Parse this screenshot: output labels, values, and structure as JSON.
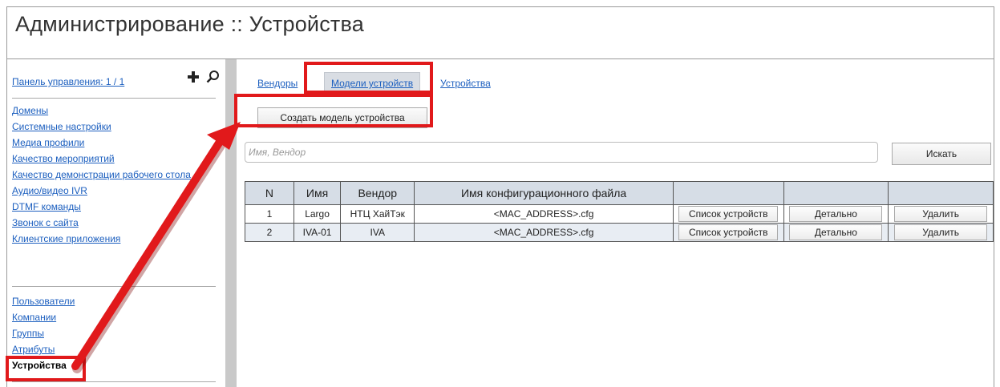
{
  "page_title": "Администрирование :: Устройства",
  "sidebar": {
    "panel_link": "Панель управления: 1 / 1",
    "add_icon": "plus-icon",
    "search_icon": "magnifier-icon",
    "group1": [
      "Домены",
      "Системные настройки",
      "Медиа профили",
      "Качество мероприятий",
      "Качество демонстрации рабочего стола",
      "Аудио/видео IVR",
      "DTMF команды",
      "Звонок с сайта",
      "Клиентские приложения"
    ],
    "group2": [
      "Пользователи",
      "Компании",
      "Группы",
      "Атрибуты",
      "Устройства"
    ],
    "active_item": "Устройства"
  },
  "tabs": [
    "Вендоры",
    "Модели устройств",
    "Устройства"
  ],
  "active_tab": "Модели устройств",
  "create_button": "Создать модель устройства",
  "search": {
    "placeholder": "Имя, Вендор",
    "button": "Искать"
  },
  "table": {
    "headers": [
      "N",
      "Имя",
      "Вендор",
      "Имя конфигурационного файла",
      "",
      "",
      ""
    ],
    "rows": [
      {
        "n": "1",
        "name": "Largo",
        "vendor": "НТЦ ХайТэк",
        "file": "<MAC_ADDRESS>.cfg",
        "b1": "Список устройств",
        "b2": "Детально",
        "b3": "Удалить"
      },
      {
        "n": "2",
        "name": "IVA-01",
        "vendor": "IVA",
        "file": "<MAC_ADDRESS>.cfg",
        "b1": "Список устройств",
        "b2": "Детально",
        "b3": "Удалить"
      }
    ]
  },
  "colors": {
    "link": "#1c5fbf",
    "highlight": "#e1191b",
    "header_bg": "#d6dde6",
    "alt_row": "#e8edf3"
  }
}
